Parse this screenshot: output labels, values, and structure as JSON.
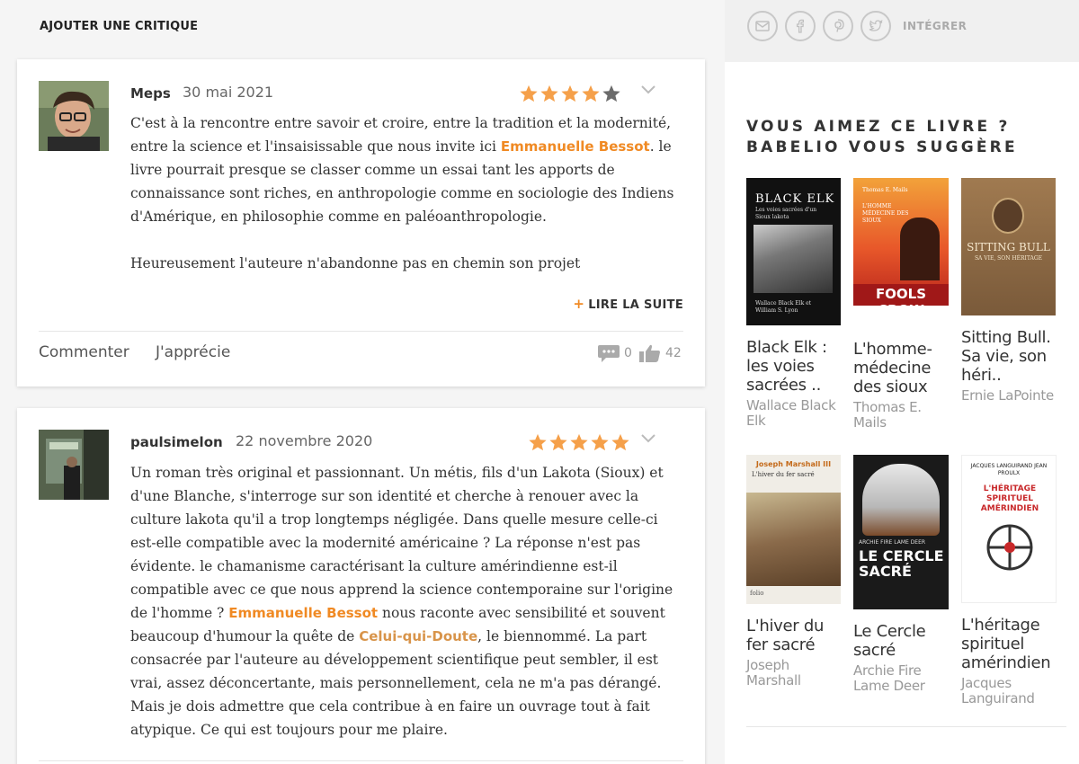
{
  "section_title": "AJOUTER UNE CRITIQUE",
  "reviews": [
    {
      "author": "Meps",
      "date": "30 mai 2021",
      "rating": 4,
      "p1_a": "C'est à la rencontre entre savoir et croire, entre la tradition et la modernité, entre la science et l'insaisissable que nous invite ici ",
      "p1_link": "Emmanuelle Bessot",
      "p1_b": ". le livre pourrait presque se classer comme un essai tant les apports de connaissance sont riches, en anthropologie comme en sociologie des Indiens d'Amérique, en philosophie comme en paléoanthropologie.",
      "p2": "Heureusement l'auteure n'abandonne pas en chemin son projet",
      "read_more": "LIRE LA SUITE",
      "comment_label": "Commenter",
      "like_label": "J'apprécie",
      "comments_count": "0",
      "likes_count": "42"
    },
    {
      "author": "paulsimelon",
      "date": "22 novembre 2020",
      "rating": 5,
      "t1": "Un roman très original et passionnant. Un métis, fils d'un Lakota (Sioux) et d'une Blanche, s'interroge sur son identité et cherche à renouer avec la culture lakota qu'il a trop longtemps négligée. Dans quelle mesure celle-ci est-elle compatible avec la modernité américaine ? La réponse n'est pas évidente. le chamanisme caractérisant la culture amérindienne est-il compatible avec ce que nous apprend la science contemporaine sur l'origine de l'homme ? ",
      "link1": "Emmanuelle Bessot",
      "t2": " nous raconte avec sensibilité et souvent beaucoup d'humour la quête de ",
      "link2": "Celui-qui-Doute",
      "t3": ", le biennommé. La part consacrée par l'auteure au développement scientifique peut sembler, il est vrai, assez déconcertante, mais personnellement, cela ne m'a pas dérangé. Mais je dois admettre que cela contribue à en faire un ouvrage tout à fait atypique. Ce qui est toujours pour me plaire."
    }
  ],
  "share": {
    "icons": [
      "mail-icon",
      "facebook-icon",
      "pinterest-icon",
      "twitter-icon"
    ],
    "integrer": "INTÉGRER"
  },
  "suggest": {
    "title": "VOUS AIMEZ CE LIVRE ? BABELIO VOUS SUGGÈRE",
    "books": [
      {
        "title": "Black Elk : les voies sacrées ..",
        "author": "Wallace Black Elk",
        "cover_text": "BLACK ELK",
        "cover_sub": "Les voies sacrées d'un Sioux lakota",
        "cover_foot": "Wallace Black Elk et William S. Lyon"
      },
      {
        "title": "L'homme-médecine des sioux",
        "author": "Thomas E. Mails",
        "cover_text": "FOOLS CROW",
        "cover_sub": "L'HOMME MÉDECINE DES SIOUX",
        "cover_top": "Thomas E. Mails"
      },
      {
        "title": "Sitting Bull. Sa vie, son héri..",
        "author": "Ernie LaPointe",
        "cover_text": "SITTING BULL",
        "cover_sub": "SA VIE, SON HÉRITAGE"
      },
      {
        "title": "L'hiver du fer sacré",
        "author": "Joseph Marshall",
        "cover_text": "Joseph Marshall III",
        "cover_sub": "L'hiver du fer sacré",
        "cover_foot": "folio"
      },
      {
        "title": "Le Cercle sacré",
        "author": "Archie Fire Lame Deer",
        "cover_text": "LE CERCLE SACRÉ",
        "cover_sub": "ARCHIE FIRE LAME DEER"
      },
      {
        "title": "L'héritage spirituel amérindien",
        "author": "Jacques Languirand",
        "cover_text": "L'HÉRITAGE SPIRITUEL AMÉRINDIEN",
        "cover_sub": "JACQUES LANGUIRAND JEAN PROULX"
      }
    ]
  },
  "colors": {
    "accent": "#f08a24",
    "star_on": "#f5a04a",
    "star_off": "#6b6b6b"
  }
}
